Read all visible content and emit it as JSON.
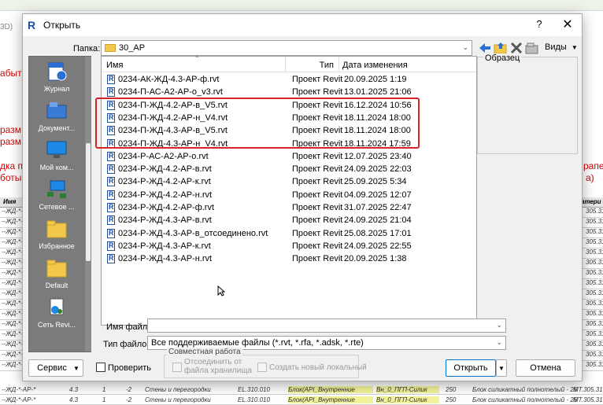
{
  "background": {
    "left_fragments": [
      "3D)",
      "абыт",
      "разм",
      "разм",
      "дка п",
      "боты"
    ],
    "right_fragments": [
      "рапет",
      "а)"
    ],
    "table_header": {
      "col1": "Имя",
      "col2": "атери"
    },
    "row_prefix": "--ЖД-*-",
    "row_suffix": "305.31",
    "bottom_rows": [
      {
        "a": "--ЖД-*-АР-*",
        "b": "4.3",
        "c": "1",
        "d": "-2",
        "e": "Стены и перегородки",
        "f": "EL.310.010",
        "g": "Блок(API_Внутренние",
        "h": "Вн_0_ПГП-Силик",
        "i": "250",
        "j": "Блок силикатный полнотелый - 25",
        "k": "МТ.305.31"
      },
      {
        "a": "--ЖД-*-АР-*",
        "b": "4.3",
        "c": "1",
        "d": "-2",
        "e": "Стены и перегородки",
        "f": "EL.310.010",
        "g": "Блок(API_Внутренние",
        "h": "Вн_0_ПГП-Силик",
        "i": "250",
        "j": "Блок силикатный полнотелый - 25",
        "k": "МТ.305.31"
      }
    ]
  },
  "dialog": {
    "title": "Открыть",
    "help_label": "?",
    "close_label": "✕",
    "folder_label": "Папка:",
    "folder_value": "30_АР",
    "views_label": "Виды",
    "preview_label": "Образец",
    "places": [
      {
        "label": "Журнал",
        "icon": "history-icon"
      },
      {
        "label": "Документ...",
        "icon": "documents-icon"
      },
      {
        "label": "Мой ком...",
        "icon": "computer-icon"
      },
      {
        "label": "Сетевое ...",
        "icon": "network-icon"
      },
      {
        "label": "Избранное",
        "icon": "folder-icon"
      },
      {
        "label": "Default",
        "icon": "folder-icon"
      },
      {
        "label": "Сеть Revi...",
        "icon": "revit-server-icon"
      }
    ],
    "columns": {
      "name": "Имя",
      "type": "Тип",
      "date": "Дата изменения"
    },
    "files": [
      {
        "name": "0234-АК-ЖД-4.3-АР-ф.rvt",
        "type": "Проект Revit",
        "date": "20.09.2025 1:19"
      },
      {
        "name": "0234-П-АС-А2-АР-о_v3.rvt",
        "type": "Проект Revit",
        "date": "13.01.2025 21:06"
      },
      {
        "name": "0234-П-ЖД-4.2-АР-в_V5.rvt",
        "type": "Проект Revit",
        "date": "16.12.2024 10:56"
      },
      {
        "name": "0234-П-ЖД-4.2-АР-н_V4.rvt",
        "type": "Проект Revit",
        "date": "18.11.2024 18:00"
      },
      {
        "name": "0234-П-ЖД-4.3-АР-в_V5.rvt",
        "type": "Проект Revit",
        "date": "18.11.2024 18:00"
      },
      {
        "name": "0234-П-ЖД-4.3-АР-н_V4.rvt",
        "type": "Проект Revit",
        "date": "18.11.2024 17:59"
      },
      {
        "name": "0234-Р-АС-А2-АР-о.rvt",
        "type": "Проект Revit",
        "date": "12.07.2025 23:40"
      },
      {
        "name": "0234-Р-ЖД-4.2-АР-в.rvt",
        "type": "Проект Revit",
        "date": "24.09.2025 22:03"
      },
      {
        "name": "0234-Р-ЖД-4.2-АР-к.rvt",
        "type": "Проект Revit",
        "date": "25.09.2025 5:34"
      },
      {
        "name": "0234-Р-ЖД-4.2-АР-н.rvt",
        "type": "Проект Revit",
        "date": "04.09.2025 12:07"
      },
      {
        "name": "0234-Р-ЖД-4.2-АР-ф.rvt",
        "type": "Проект Revit",
        "date": "31.07.2025 22:47"
      },
      {
        "name": "0234-Р-ЖД-4.3-АР-в.rvt",
        "type": "Проект Revit",
        "date": "24.09.2025 21:04"
      },
      {
        "name": "0234-Р-ЖД-4.3-АР-в_отсоединено.rvt",
        "type": "Проект Revit",
        "date": "25.08.2025 17:01"
      },
      {
        "name": "0234-Р-ЖД-4.3-АР-к.rvt",
        "type": "Проект Revit",
        "date": "24.09.2025 22:55"
      },
      {
        "name": "0234-Р-ЖД-4.3-АР-н.rvt",
        "type": "Проект Revit",
        "date": "20.09.2025 1:38"
      }
    ],
    "filename_label": "Имя файла:",
    "filename_value": "",
    "filetype_label": "Тип файлов:",
    "filetype_value": "Все поддерживаемые файлы  (*.rvt, *.rfa, *.adsk, *.rte)",
    "service_label": "Сервис",
    "verify_label": "Проверить",
    "worksharing_title": "Совместная работа",
    "detach_label_1": "Отсоединить от",
    "detach_label_2": "файла хранилища",
    "create_local_label": "Создать новый локальный",
    "open_label": "Открыть",
    "cancel_label": "Отмена",
    "accent_color": "#0078d7",
    "highlight_color": "#d8232a"
  }
}
